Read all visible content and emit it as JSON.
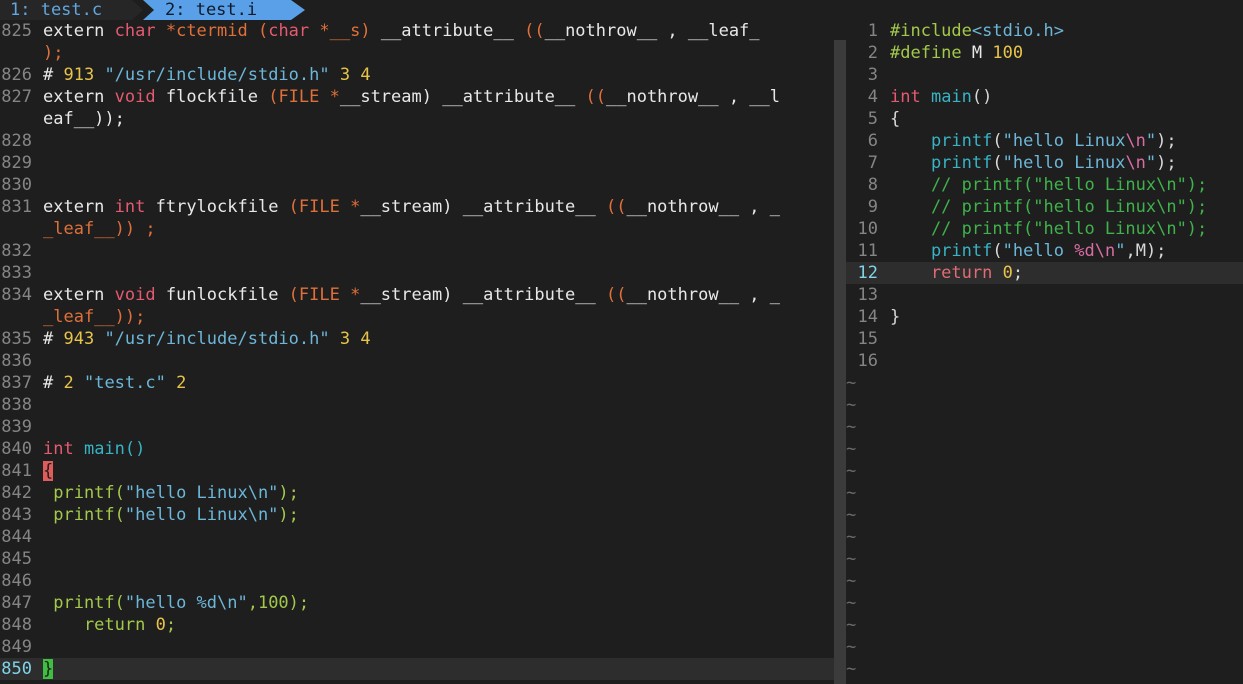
{
  "tabs": [
    {
      "label": "1: test.c",
      "active": false
    },
    {
      "label": "2: test.i",
      "active": true
    }
  ],
  "left_pane": {
    "file": "test.i",
    "lines": [
      {
        "n": "825",
        "segs": [
          [
            "extern ",
            "pp"
          ],
          [
            "char",
            "ty"
          ],
          [
            " *ctermid (",
            "orange"
          ],
          [
            "char",
            "ty"
          ],
          [
            " *__s) ",
            "orange"
          ],
          [
            "__attribute__ ",
            "pp"
          ],
          [
            "((",
            "orange"
          ],
          [
            "__nothrow__ , __leaf_",
            "pp"
          ]
        ]
      },
      {
        "n": "",
        "segs": [
          [
            ");",
            "orange"
          ]
        ]
      },
      {
        "n": "826",
        "segs": [
          [
            "# ",
            "pp"
          ],
          [
            "913 ",
            "num"
          ],
          [
            "\"/usr/include/stdio.h\"",
            "str"
          ],
          [
            " 3 4",
            "num"
          ]
        ]
      },
      {
        "n": "827",
        "segs": [
          [
            "extern ",
            "pp"
          ],
          [
            "void",
            "ty"
          ],
          [
            " flockfile ",
            "pp"
          ],
          [
            "(FILE *",
            "orange"
          ],
          [
            "__stream) ",
            "pp"
          ],
          [
            "__attribute__ ",
            "pp"
          ],
          [
            "((",
            "orange"
          ],
          [
            "__nothrow__ , __l",
            "pp"
          ]
        ]
      },
      {
        "n": "",
        "segs": [
          [
            "eaf__));",
            "pp"
          ]
        ]
      },
      {
        "n": "828",
        "segs": []
      },
      {
        "n": "829",
        "segs": []
      },
      {
        "n": "830",
        "segs": []
      },
      {
        "n": "831",
        "segs": [
          [
            "extern ",
            "pp"
          ],
          [
            "int",
            "ty"
          ],
          [
            " ftrylockfile ",
            "pp"
          ],
          [
            "(FILE *",
            "orange"
          ],
          [
            "__stream) ",
            "pp"
          ],
          [
            "__attribute__ ",
            "pp"
          ],
          [
            "((",
            "orange"
          ],
          [
            "__nothrow__ , _",
            "pp"
          ]
        ]
      },
      {
        "n": "",
        "segs": [
          [
            "_leaf__)) ;",
            "orange"
          ]
        ]
      },
      {
        "n": "832",
        "segs": []
      },
      {
        "n": "833",
        "segs": []
      },
      {
        "n": "834",
        "segs": [
          [
            "extern ",
            "pp"
          ],
          [
            "void",
            "ty"
          ],
          [
            " funlockfile ",
            "pp"
          ],
          [
            "(FILE *",
            "orange"
          ],
          [
            "__stream) ",
            "pp"
          ],
          [
            "__attribute__ ",
            "pp"
          ],
          [
            "((",
            "orange"
          ],
          [
            "__nothrow__ , _",
            "pp"
          ]
        ]
      },
      {
        "n": "",
        "segs": [
          [
            "_leaf__));",
            "orange"
          ]
        ]
      },
      {
        "n": "835",
        "segs": [
          [
            "# ",
            "pp"
          ],
          [
            "943 ",
            "num"
          ],
          [
            "\"/usr/include/stdio.h\"",
            "str"
          ],
          [
            " 3 4",
            "num"
          ]
        ]
      },
      {
        "n": "836",
        "segs": []
      },
      {
        "n": "837",
        "segs": [
          [
            "# ",
            "pp"
          ],
          [
            "2 ",
            "num"
          ],
          [
            "\"test.c\"",
            "str"
          ],
          [
            " 2",
            "num"
          ]
        ]
      },
      {
        "n": "838",
        "segs": []
      },
      {
        "n": "839",
        "segs": []
      },
      {
        "n": "840",
        "segs": [
          [
            "int",
            "ty"
          ],
          [
            " main()",
            "cyan"
          ]
        ]
      },
      {
        "n": "841",
        "segs": [
          [
            "{",
            "brace-hl"
          ]
        ]
      },
      {
        "n": "842",
        "segs": [
          [
            " printf(",
            "green"
          ],
          [
            "\"hello Linux\\n\"",
            "str"
          ],
          [
            ");",
            "green"
          ]
        ]
      },
      {
        "n": "843",
        "segs": [
          [
            " printf(",
            "green"
          ],
          [
            "\"hello Linux\\n\"",
            "str"
          ],
          [
            ");",
            "green"
          ]
        ]
      },
      {
        "n": "844",
        "segs": []
      },
      {
        "n": "845",
        "segs": []
      },
      {
        "n": "846",
        "segs": []
      },
      {
        "n": "847",
        "segs": [
          [
            " printf(",
            "green"
          ],
          [
            "\"hello %d\\n\"",
            "str"
          ],
          [
            ",100);",
            "green"
          ]
        ]
      },
      {
        "n": "848",
        "segs": [
          [
            "    return ",
            "green"
          ],
          [
            "0",
            "num"
          ],
          [
            ";",
            "green"
          ]
        ]
      },
      {
        "n": "849",
        "segs": []
      },
      {
        "n": "850",
        "segs": [
          [
            "}",
            "brace-ok"
          ]
        ],
        "current": true
      }
    ]
  },
  "right_pane": {
    "file": "test.c",
    "lines": [
      {
        "n": "1",
        "segs": [
          [
            "#include",
            "green"
          ],
          [
            "<stdio.h>",
            "str"
          ]
        ]
      },
      {
        "n": "2",
        "segs": [
          [
            "#define ",
            "green"
          ],
          [
            "M ",
            "pp"
          ],
          [
            "100",
            "num"
          ]
        ]
      },
      {
        "n": "3",
        "segs": []
      },
      {
        "n": "4",
        "segs": [
          [
            "int",
            "ty"
          ],
          [
            " main",
            "cyan"
          ],
          [
            "()",
            "punc"
          ]
        ]
      },
      {
        "n": "5",
        "segs": [
          [
            "{",
            "punc"
          ]
        ]
      },
      {
        "n": "6",
        "segs": [
          [
            "    printf",
            "fn"
          ],
          [
            "(",
            "punc"
          ],
          [
            "\"hello Linux",
            "str"
          ],
          [
            "\\n",
            "esc"
          ],
          [
            "\"",
            "str"
          ],
          [
            ");",
            "punc"
          ]
        ]
      },
      {
        "n": "7",
        "segs": [
          [
            "    printf",
            "fn"
          ],
          [
            "(",
            "punc"
          ],
          [
            "\"hello Linux",
            "str"
          ],
          [
            "\\n",
            "esc"
          ],
          [
            "\"",
            "str"
          ],
          [
            ");",
            "punc"
          ]
        ]
      },
      {
        "n": "8",
        "segs": [
          [
            "    // printf(\"hello Linux\\n\");",
            "cmt"
          ]
        ]
      },
      {
        "n": "9",
        "segs": [
          [
            "    // printf(\"hello Linux\\n\");",
            "cmt"
          ]
        ]
      },
      {
        "n": "10",
        "segs": [
          [
            "    // printf(\"hello Linux\\n\");",
            "cmt"
          ]
        ]
      },
      {
        "n": "11",
        "segs": [
          [
            "    printf",
            "fn"
          ],
          [
            "(",
            "punc"
          ],
          [
            "\"hello ",
            "str"
          ],
          [
            "%d\\n",
            "esc"
          ],
          [
            "\"",
            "str"
          ],
          [
            ",M);",
            "punc"
          ]
        ]
      },
      {
        "n": "12",
        "segs": [
          [
            "    return ",
            "kw"
          ],
          [
            "0",
            "num"
          ],
          [
            ";",
            "punc"
          ]
        ],
        "current": true
      },
      {
        "n": "13",
        "segs": []
      },
      {
        "n": "14",
        "segs": [
          [
            "}",
            "punc"
          ]
        ]
      },
      {
        "n": "15",
        "segs": []
      },
      {
        "n": "16",
        "segs": []
      }
    ],
    "filler": "~"
  }
}
